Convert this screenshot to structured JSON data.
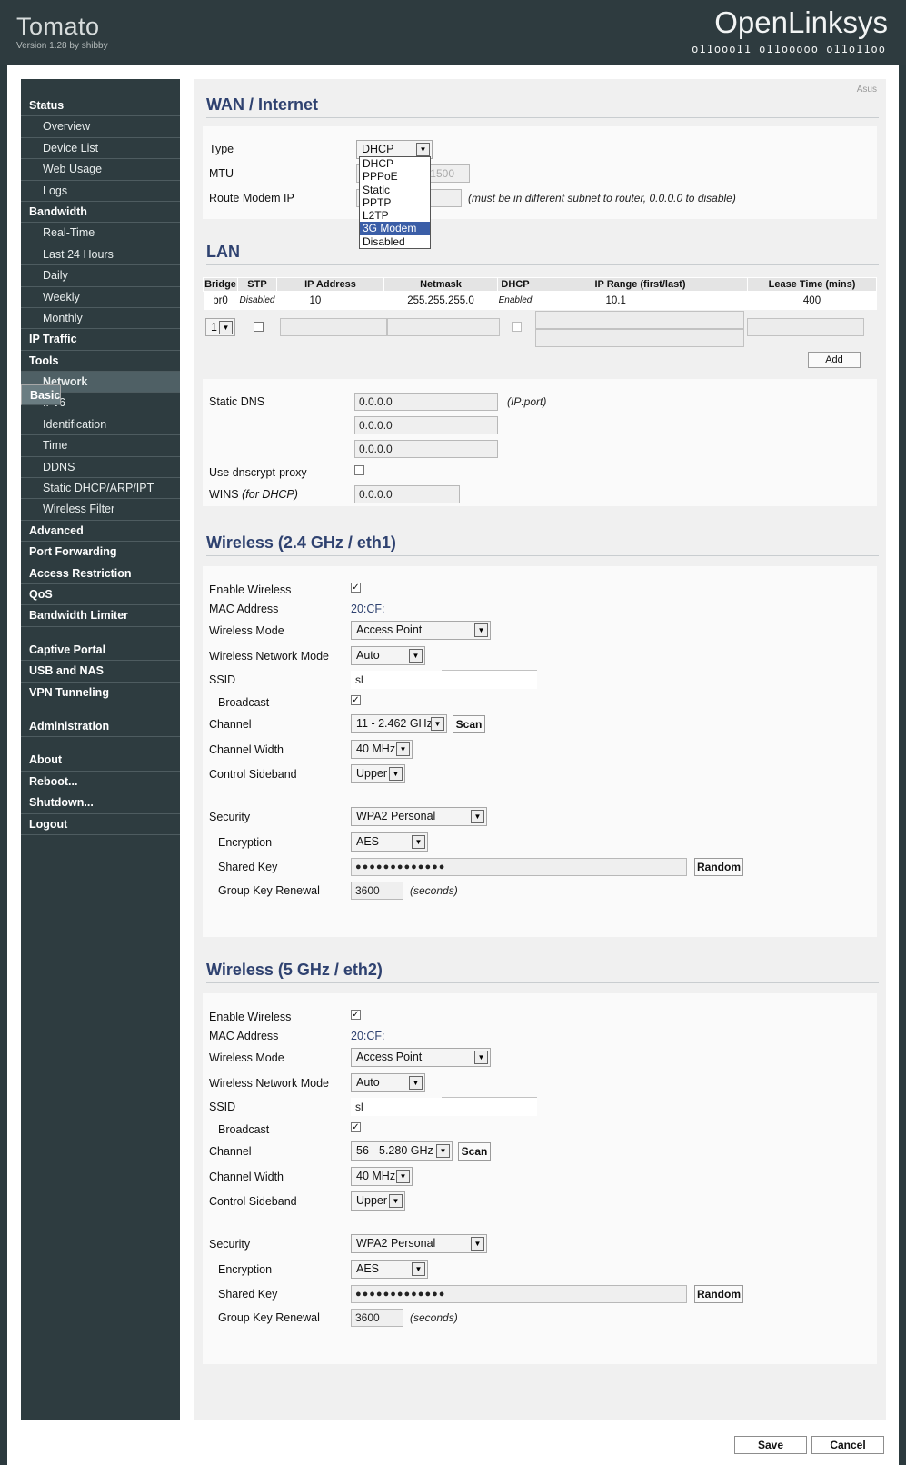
{
  "header": {
    "brand": "Tomato",
    "version": "Version 1.28 by shibby",
    "product": "OpenLinksys",
    "binary": "o11ooo11 o11ooooo o11o11oo"
  },
  "sidebar": {
    "items": [
      {
        "label": "Status",
        "kind": "h"
      },
      {
        "label": "Overview",
        "kind": "sub"
      },
      {
        "label": "Device List",
        "kind": "sub"
      },
      {
        "label": "Web Usage",
        "kind": "sub"
      },
      {
        "label": "Logs",
        "kind": "sub"
      },
      {
        "label": "Bandwidth",
        "kind": "h"
      },
      {
        "label": "Real-Time",
        "kind": "sub"
      },
      {
        "label": "Last 24 Hours",
        "kind": "sub"
      },
      {
        "label": "Daily",
        "kind": "sub"
      },
      {
        "label": "Weekly",
        "kind": "sub"
      },
      {
        "label": "Monthly",
        "kind": "sub"
      },
      {
        "label": "IP Traffic",
        "kind": "h"
      },
      {
        "label": "Tools",
        "kind": "h"
      },
      {
        "label": "Basic",
        "kind": "h sel gap"
      },
      {
        "label": "Network",
        "kind": "sub selsub"
      },
      {
        "label": "IPv6",
        "kind": "sub"
      },
      {
        "label": "Identification",
        "kind": "sub"
      },
      {
        "label": "Time",
        "kind": "sub"
      },
      {
        "label": "DDNS",
        "kind": "sub"
      },
      {
        "label": "Static DHCP/ARP/IPT",
        "kind": "sub"
      },
      {
        "label": "Wireless Filter",
        "kind": "sub"
      },
      {
        "label": "Advanced",
        "kind": "h"
      },
      {
        "label": "Port Forwarding",
        "kind": "h"
      },
      {
        "label": "Access Restriction",
        "kind": "h"
      },
      {
        "label": "QoS",
        "kind": "h"
      },
      {
        "label": "Bandwidth Limiter",
        "kind": "h"
      },
      {
        "label": "Captive Portal",
        "kind": "h gap"
      },
      {
        "label": "USB and NAS",
        "kind": "h"
      },
      {
        "label": "VPN Tunneling",
        "kind": "h"
      },
      {
        "label": "Administration",
        "kind": "h gap"
      },
      {
        "label": "About",
        "kind": "h gap"
      },
      {
        "label": "Reboot...",
        "kind": "h"
      },
      {
        "label": "Shutdown...",
        "kind": "h"
      },
      {
        "label": "Logout",
        "kind": "h"
      }
    ]
  },
  "content": {
    "router_name": "Asus",
    "wan": {
      "title": "WAN / Internet",
      "type_label": "Type",
      "type_value": "DHCP",
      "type_options": [
        "DHCP",
        "PPPoE",
        "Static",
        "PPTP",
        "L2TP",
        "3G Modem",
        "Disabled"
      ],
      "type_highlight_index": 5,
      "mtu_label": "MTU",
      "mtu_value": "1500",
      "route_modem_label": "Route Modem IP",
      "route_modem_note": "(must be in different subnet to router, 0.0.0.0 to disable)"
    },
    "lan": {
      "title": "LAN",
      "headers": [
        "Bridge",
        "STP",
        "IP Address",
        "Netmask",
        "DHCP",
        "IP Range (first/last)",
        "Lease Time (mins)"
      ],
      "row": {
        "bridge": "br0",
        "stp": "Disabled",
        "ip": "10",
        "netmask": "255.255.255.0",
        "dhcp": "Enabled",
        "range": "10.1",
        "lease": "400"
      },
      "new_bridge": "1",
      "add_label": "Add",
      "static_dns_label": "Static DNS",
      "dns": [
        "0.0.0.0",
        "0.0.0.0",
        "0.0.0.0"
      ],
      "dns_note": "(IP:port)",
      "dnscrypt_label": "Use dnscrypt-proxy",
      "wins_label": "WINS",
      "wins_note": "(for DHCP)",
      "wins_value": "0.0.0.0"
    },
    "wl24": {
      "title": "Wireless (2.4 GHz / eth1)",
      "enable_label": "Enable Wireless",
      "mac_label": "MAC Address",
      "mac_value": "20:CF:",
      "mode_label": "Wireless Mode",
      "mode_value": "Access Point",
      "netmode_label": "Wireless Network Mode",
      "netmode_value": "Auto",
      "ssid_label": "SSID",
      "ssid_value": "sl",
      "broadcast_label": "Broadcast",
      "channel_label": "Channel",
      "channel_value": "11 - 2.462 GHz",
      "scan_label": "Scan",
      "width_label": "Channel Width",
      "width_value": "40 MHz",
      "sideband_label": "Control Sideband",
      "sideband_value": "Upper",
      "security_label": "Security",
      "security_value": "WPA2 Personal",
      "encryption_label": "Encryption",
      "encryption_value": "AES",
      "key_label": "Shared Key",
      "key_value": "●●●●●●●●●●●●●",
      "random_label": "Random",
      "renewal_label": "Group Key Renewal",
      "renewal_value": "3600",
      "renewal_note": "(seconds)"
    },
    "wl5": {
      "title": "Wireless (5 GHz / eth2)",
      "enable_label": "Enable Wireless",
      "mac_label": "MAC Address",
      "mac_value": "20:CF:",
      "mode_label": "Wireless Mode",
      "mode_value": "Access Point",
      "netmode_label": "Wireless Network Mode",
      "netmode_value": "Auto",
      "ssid_label": "SSID",
      "ssid_value": "sl",
      "broadcast_label": "Broadcast",
      "channel_label": "Channel",
      "channel_value": "56 - 5.280 GHz",
      "scan_label": "Scan",
      "width_label": "Channel Width",
      "width_value": "40 MHz",
      "sideband_label": "Control Sideband",
      "sideband_value": "Upper",
      "security_label": "Security",
      "security_value": "WPA2 Personal",
      "encryption_label": "Encryption",
      "encryption_value": "AES",
      "key_label": "Shared Key",
      "key_value": "●●●●●●●●●●●●●",
      "random_label": "Random",
      "renewal_label": "Group Key Renewal",
      "renewal_value": "3600",
      "renewal_note": "(seconds)"
    }
  },
  "footer": {
    "save_label": "Save",
    "cancel_label": "Cancel"
  },
  "icons": {
    "dropdown_arrow": "▼",
    "checkmark": "✓"
  }
}
